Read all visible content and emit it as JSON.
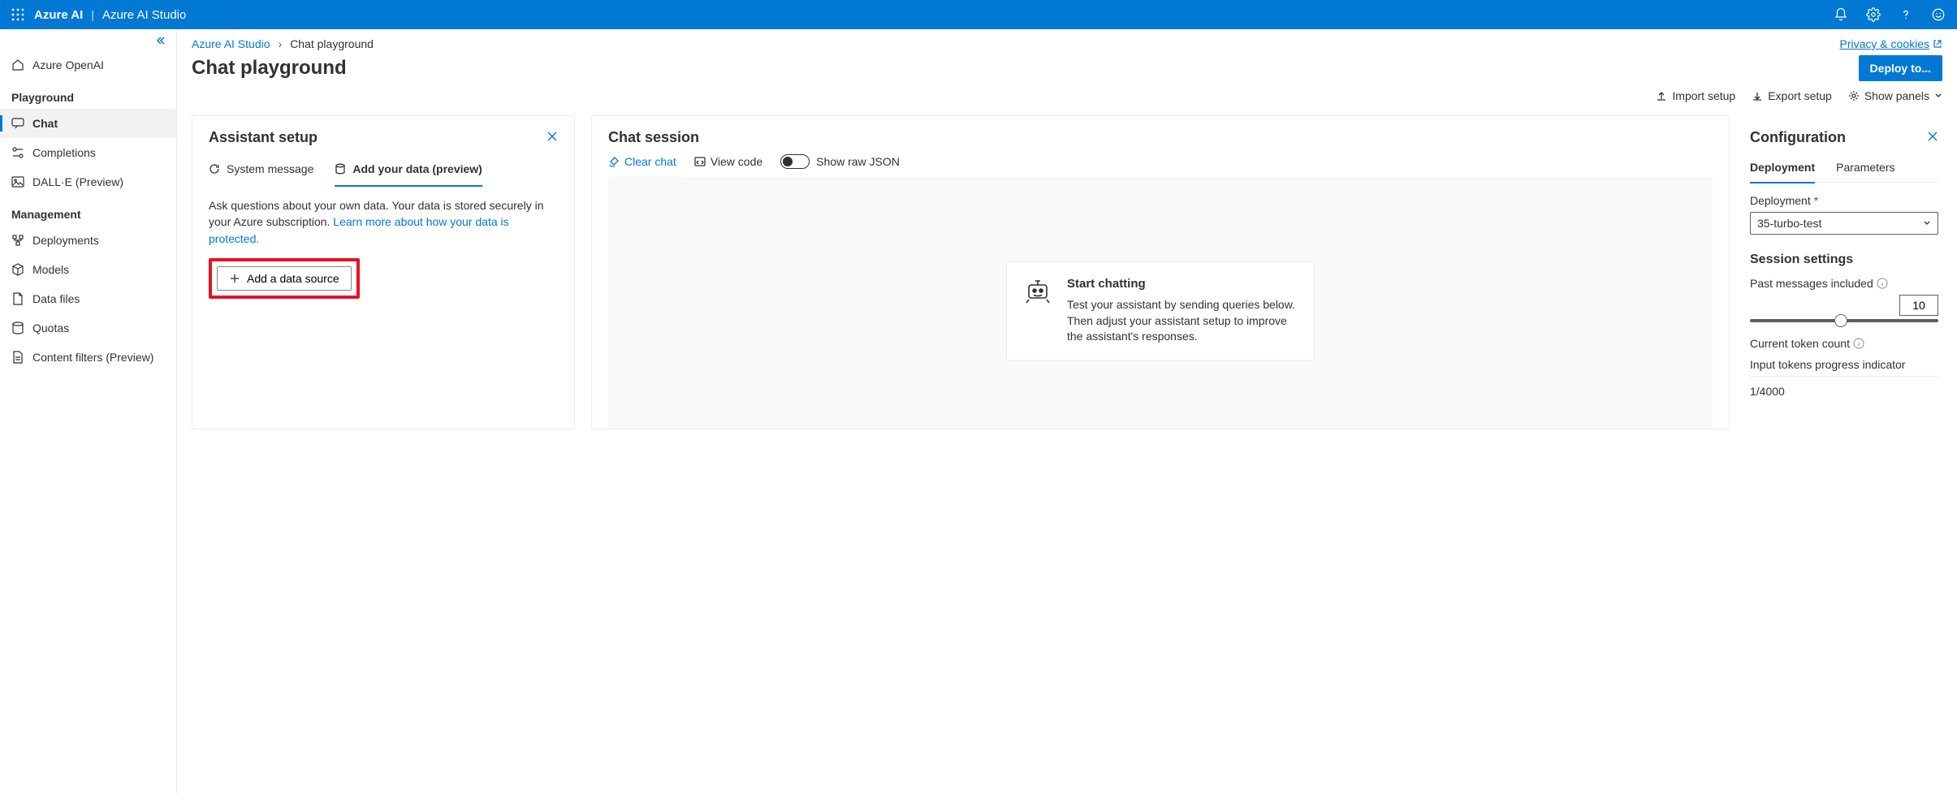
{
  "header": {
    "brand": "Azure AI",
    "brand_sub": "Azure AI Studio"
  },
  "sidebar": {
    "azure_openai": "Azure OpenAI",
    "section_playground": "Playground",
    "chat": "Chat",
    "completions": "Completions",
    "dalle": "DALL·E (Preview)",
    "section_management": "Management",
    "deployments": "Deployments",
    "models": "Models",
    "data_files": "Data files",
    "quotas": "Quotas",
    "content_filters": "Content filters (Preview)"
  },
  "breadcrumb": {
    "root": "Azure AI Studio",
    "current": "Chat playground",
    "privacy": "Privacy & cookies"
  },
  "page": {
    "title": "Chat playground",
    "deploy": "Deploy to...",
    "import": "Import setup",
    "export": "Export setup",
    "show_panels": "Show panels"
  },
  "assistant": {
    "title": "Assistant setup",
    "tab_system": "System message",
    "tab_data": "Add your data (preview)",
    "desc_prefix": "Ask questions about your own data. Your data is stored securely in your Azure subscription. ",
    "desc_link": "Learn more about how your data is protected.",
    "add_btn": "Add a data source"
  },
  "session": {
    "title": "Chat session",
    "clear": "Clear chat",
    "view_code": "View code",
    "show_raw": "Show raw JSON",
    "card_title": "Start chatting",
    "card_body": "Test your assistant by sending queries below. Then adjust your assistant setup to improve the assistant's responses."
  },
  "config": {
    "title": "Configuration",
    "tab_deployment": "Deployment",
    "tab_parameters": "Parameters",
    "deployment_label": "Deployment",
    "deployment_value": "35-turbo-test",
    "session_settings": "Session settings",
    "past_messages": "Past messages included",
    "past_messages_value": "10",
    "token_count_label": "Current token count",
    "input_tokens_label": "Input tokens progress indicator",
    "input_tokens_value": "1/4000"
  }
}
